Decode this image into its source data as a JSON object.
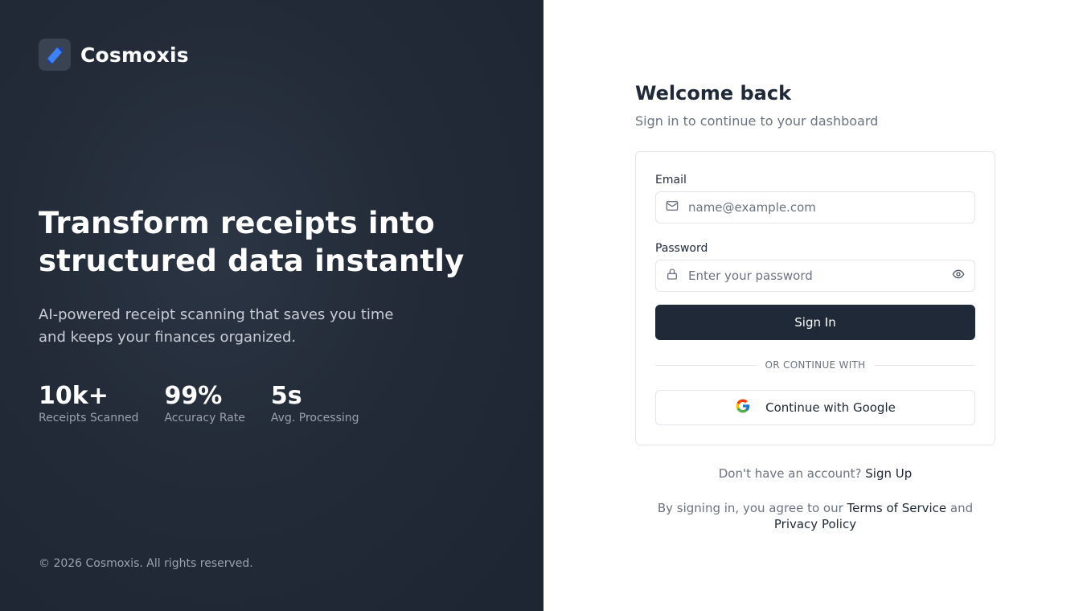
{
  "brand": {
    "name": "Cosmoxis",
    "logo_icon": "cosmoxis-logo-icon"
  },
  "hero": {
    "headline": "Transform receipts into structured data instantly",
    "description": "AI-powered receipt scanning that saves you time and keeps your finances organized."
  },
  "stats": [
    {
      "value": "10k+",
      "label": "Receipts Scanned"
    },
    {
      "value": "99%",
      "label": "Accuracy Rate"
    },
    {
      "value": "5s",
      "label": "Avg. Processing"
    }
  ],
  "footer": {
    "copyright": "© 2026 Cosmoxis. All rights reserved."
  },
  "login": {
    "title": "Welcome back",
    "subtitle": "Sign in to continue to your dashboard",
    "email": {
      "label": "Email",
      "placeholder": "name@example.com",
      "value": "",
      "icon": "mail-icon"
    },
    "password": {
      "label": "Password",
      "placeholder": "Enter your password",
      "value": "",
      "icon": "lock-icon",
      "toggle_icon": "eye-icon"
    },
    "submit_label": "Sign In",
    "divider_text": "OR CONTINUE WITH",
    "google_label": "Continue with Google",
    "signup_prompt": "Don't have an account?",
    "signup_link": "Sign Up",
    "terms_prefix": "By signing in, you agree to our",
    "terms_link": "Terms of Service",
    "terms_and": "and",
    "privacy_link": "Privacy Policy"
  },
  "colors": {
    "left_panel_bg": "#1e2533",
    "primary_button": "#1f2937",
    "logo_accent": "#3b82f6",
    "muted_text": "#6b7280"
  }
}
